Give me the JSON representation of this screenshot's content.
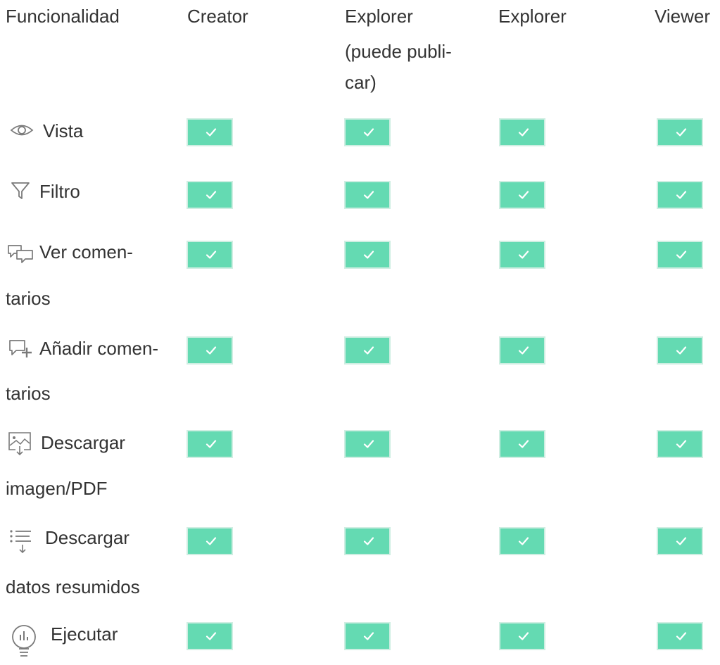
{
  "header": {
    "feature": "Funcionalidad",
    "creator": "Creator",
    "explorer_publish_lines": [
      "Explorer",
      "(puede publi-",
      "car)"
    ],
    "explorer": "Explorer",
    "viewer": "Viewer"
  },
  "rows": [
    {
      "icon": "eye-icon",
      "label_lines": [
        "Vista"
      ],
      "checks": [
        true,
        true,
        true,
        true
      ]
    },
    {
      "icon": "filter-icon",
      "label_lines": [
        "Filtro"
      ],
      "checks": [
        true,
        true,
        true,
        true
      ]
    },
    {
      "icon": "comments-icon",
      "label_lines": [
        "Ver comen-",
        "tarios"
      ],
      "checks": [
        true,
        true,
        true,
        true
      ]
    },
    {
      "icon": "add-comment-icon",
      "label_lines": [
        "Añadir comen-",
        "tarios"
      ],
      "checks": [
        true,
        true,
        true,
        true
      ]
    },
    {
      "icon": "download-image-icon",
      "label_lines": [
        "Descargar",
        "imagen/PDF"
      ],
      "checks": [
        true,
        true,
        true,
        true
      ]
    },
    {
      "icon": "download-data-icon",
      "label_lines": [
        "Descargar",
        "datos resumidos"
      ],
      "checks": [
        true,
        true,
        true,
        true
      ]
    },
    {
      "icon": "lightbulb-icon",
      "label_lines": [
        "Ejecutar"
      ],
      "checks": [
        true,
        true,
        true,
        true
      ]
    }
  ],
  "colors": {
    "check_fill": "#64dab2",
    "check_border": "#cfeee2",
    "text": "#333333",
    "icon": "#7a7a7a"
  }
}
